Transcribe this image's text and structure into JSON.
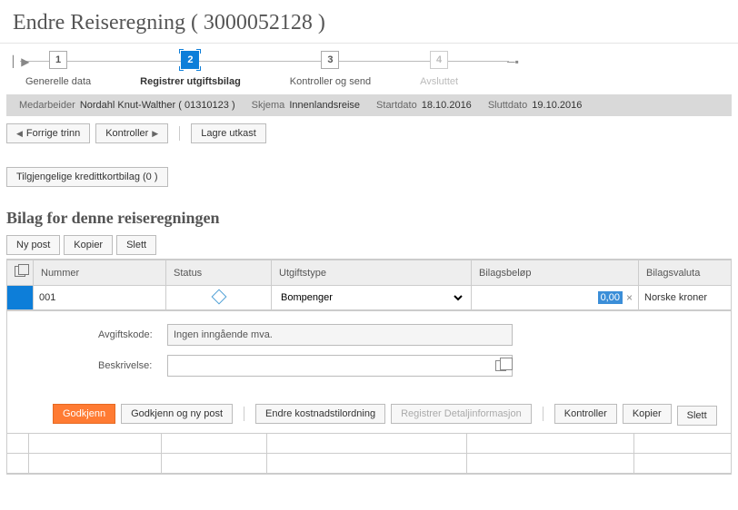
{
  "page_title": "Endre Reiseregning ( 3000052128 )",
  "wizard": {
    "steps": [
      {
        "num": "1",
        "label": "Generelle data"
      },
      {
        "num": "2",
        "label": "Registrer utgiftsbilag"
      },
      {
        "num": "3",
        "label": "Kontroller og send"
      },
      {
        "num": "4",
        "label": "Avsluttet"
      }
    ],
    "active_index": 1
  },
  "info": {
    "employee_label": "Medarbeider",
    "employee_value": "Nordahl Knut-Walther ( 01310123 )",
    "schema_label": "Skjema",
    "schema_value": "Innenlandsreise",
    "start_label": "Startdato",
    "start_value": "18.10.2016",
    "end_label": "Sluttdato",
    "end_value": "19.10.2016"
  },
  "toolbar": {
    "prev": "Forrige trinn",
    "check": "Kontroller",
    "save": "Lagre utkast"
  },
  "credit_button": "Tilgjengelige kredittkortbilag (0 )",
  "section_title": "Bilag for denne reiseregningen",
  "tbl_toolbar": {
    "new": "Ny post",
    "copy": "Kopier",
    "delete": "Slett"
  },
  "columns": {
    "number": "Nummer",
    "status": "Status",
    "type": "Utgiftstype",
    "amount": "Bilagsbeløp",
    "currency": "Bilagsvaluta"
  },
  "row": {
    "number": "001",
    "type": "Bompenger",
    "amount": "0,00",
    "currency": "Norske kroner"
  },
  "detail": {
    "tax_label": "Avgiftskode:",
    "tax_value": "Ingen inngående mva.",
    "desc_label": "Beskrivelse:",
    "desc_value": ""
  },
  "actions": {
    "approve": "Godkjenn",
    "approve_new": "Godkjenn og ny post",
    "change_cost": "Endre kostnadstilordning",
    "reg_detail": "Registrer Detaljinformasjon",
    "check": "Kontroller",
    "copy": "Kopier",
    "delete": "Slett"
  }
}
